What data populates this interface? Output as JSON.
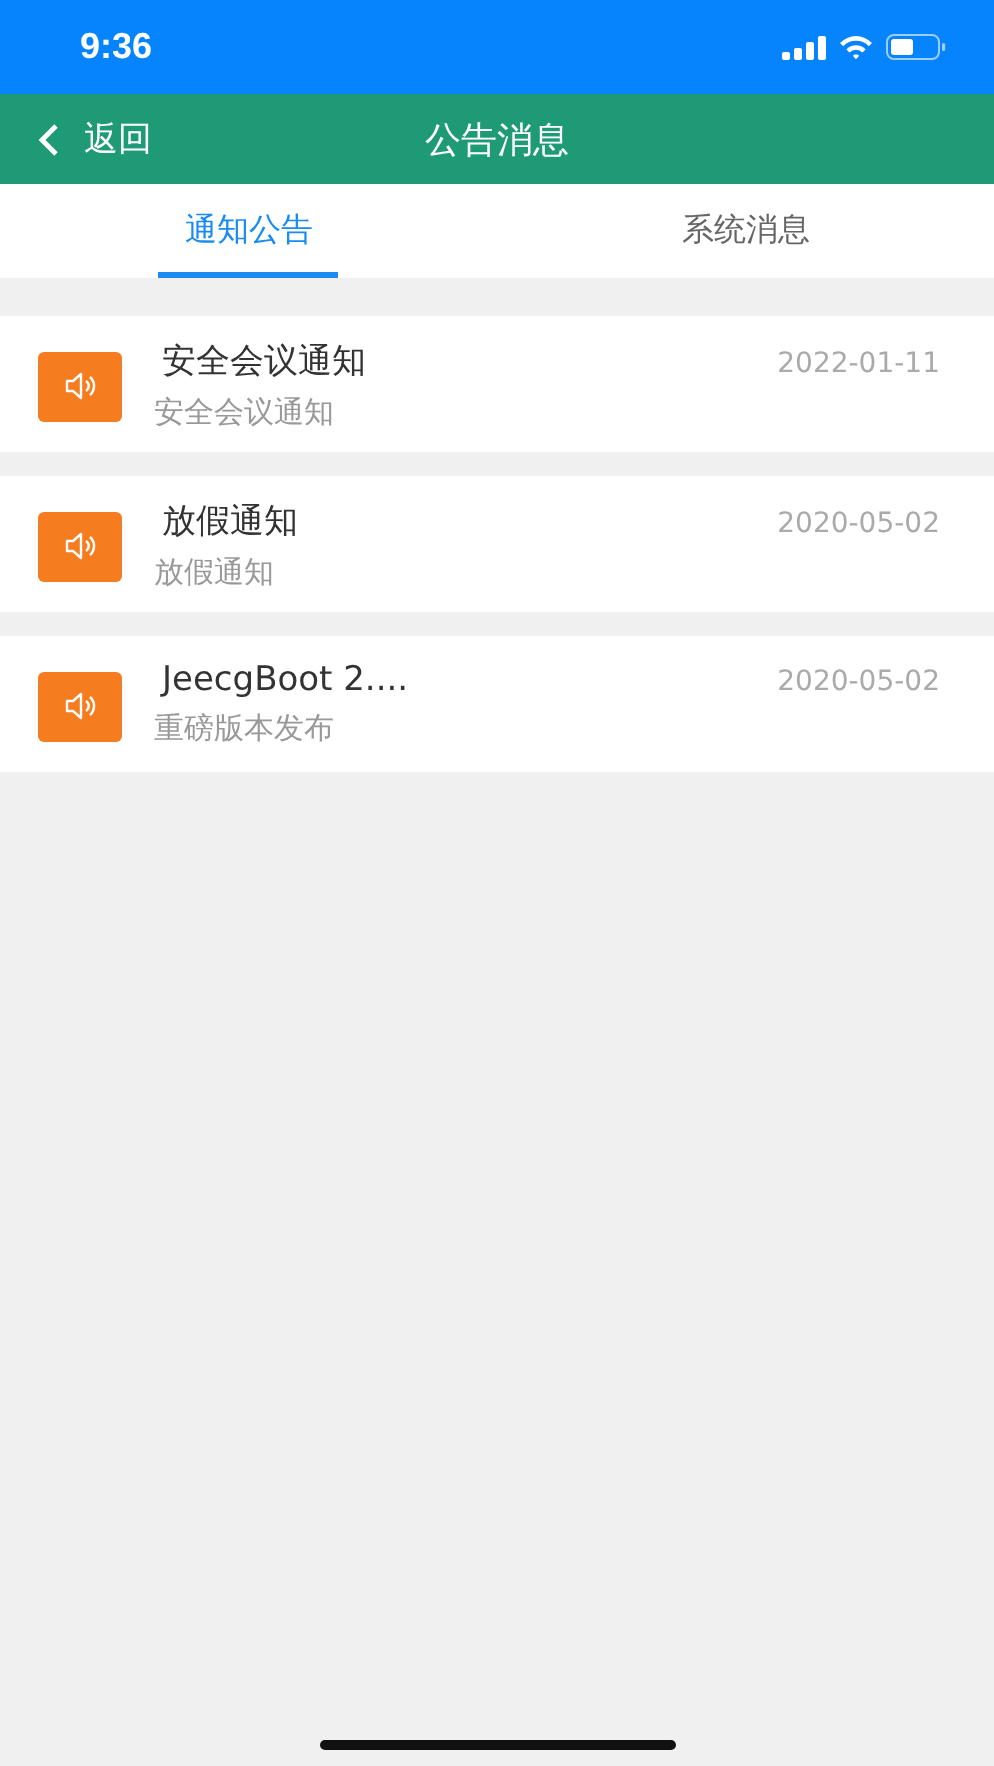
{
  "status_bar": {
    "time": "9:36"
  },
  "nav_bar": {
    "back_label": "返回",
    "title": "公告消息"
  },
  "tabs": [
    {
      "label": "通知公告",
      "selected": true
    },
    {
      "label": "系统消息",
      "selected": false
    }
  ],
  "notices": [
    {
      "title": "安全会议通知",
      "summary": "安全会议通知",
      "date": "2022-01-11"
    },
    {
      "title": "放假通知",
      "summary": "放假通知",
      "date": "2020-05-02"
    },
    {
      "title": "JeecgBoot 2....",
      "summary": "重磅版本发布",
      "date": "2020-05-02"
    }
  ]
}
